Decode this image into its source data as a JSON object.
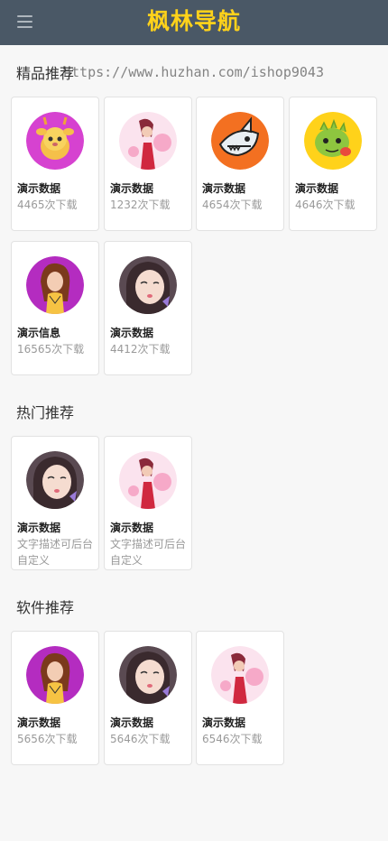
{
  "header": {
    "title": "枫林导航",
    "menu_icon": "hamburger-menu-icon"
  },
  "watermark": "https://www.huzhan.com/ishop9043",
  "sections": [
    {
      "title": "精品推荐",
      "items": [
        {
          "name": "演示数据",
          "sub": "4465次下载",
          "icon": "deer-avatar-icon"
        },
        {
          "name": "演示数据",
          "sub": "1232次下载",
          "icon": "woman-red-dress-avatar-icon"
        },
        {
          "name": "演示数据",
          "sub": "4654次下载",
          "icon": "cartoon-shark-avatar-icon"
        },
        {
          "name": "演示数据",
          "sub": "4646次下载",
          "icon": "green-dragon-avatar-icon"
        },
        {
          "name": "演示信息",
          "sub": "16565次下载",
          "icon": "woman-purple-avatar-icon"
        },
        {
          "name": "演示数据",
          "sub": "4412次下载",
          "icon": "girl-portrait-avatar-icon"
        }
      ]
    },
    {
      "title": "热门推荐",
      "items": [
        {
          "name": "演示数据",
          "sub": "文字描述可后台自定义",
          "icon": "girl-portrait-avatar-icon"
        },
        {
          "name": "演示数据",
          "sub": "文字描述可后台自定义",
          "icon": "woman-red-dress-avatar-icon"
        }
      ]
    },
    {
      "title": "软件推荐",
      "items": [
        {
          "name": "演示数据",
          "sub": "5656次下载",
          "icon": "woman-purple-avatar-icon"
        },
        {
          "name": "演示数据",
          "sub": "5646次下载",
          "icon": "girl-portrait-avatar-icon"
        },
        {
          "name": "演示数据",
          "sub": "6546次下载",
          "icon": "woman-red-dress-avatar-icon"
        }
      ]
    }
  ],
  "colors": {
    "header_bg": "#4a5866",
    "title": "#ffd21a",
    "page_bg": "#f7f7f7"
  }
}
